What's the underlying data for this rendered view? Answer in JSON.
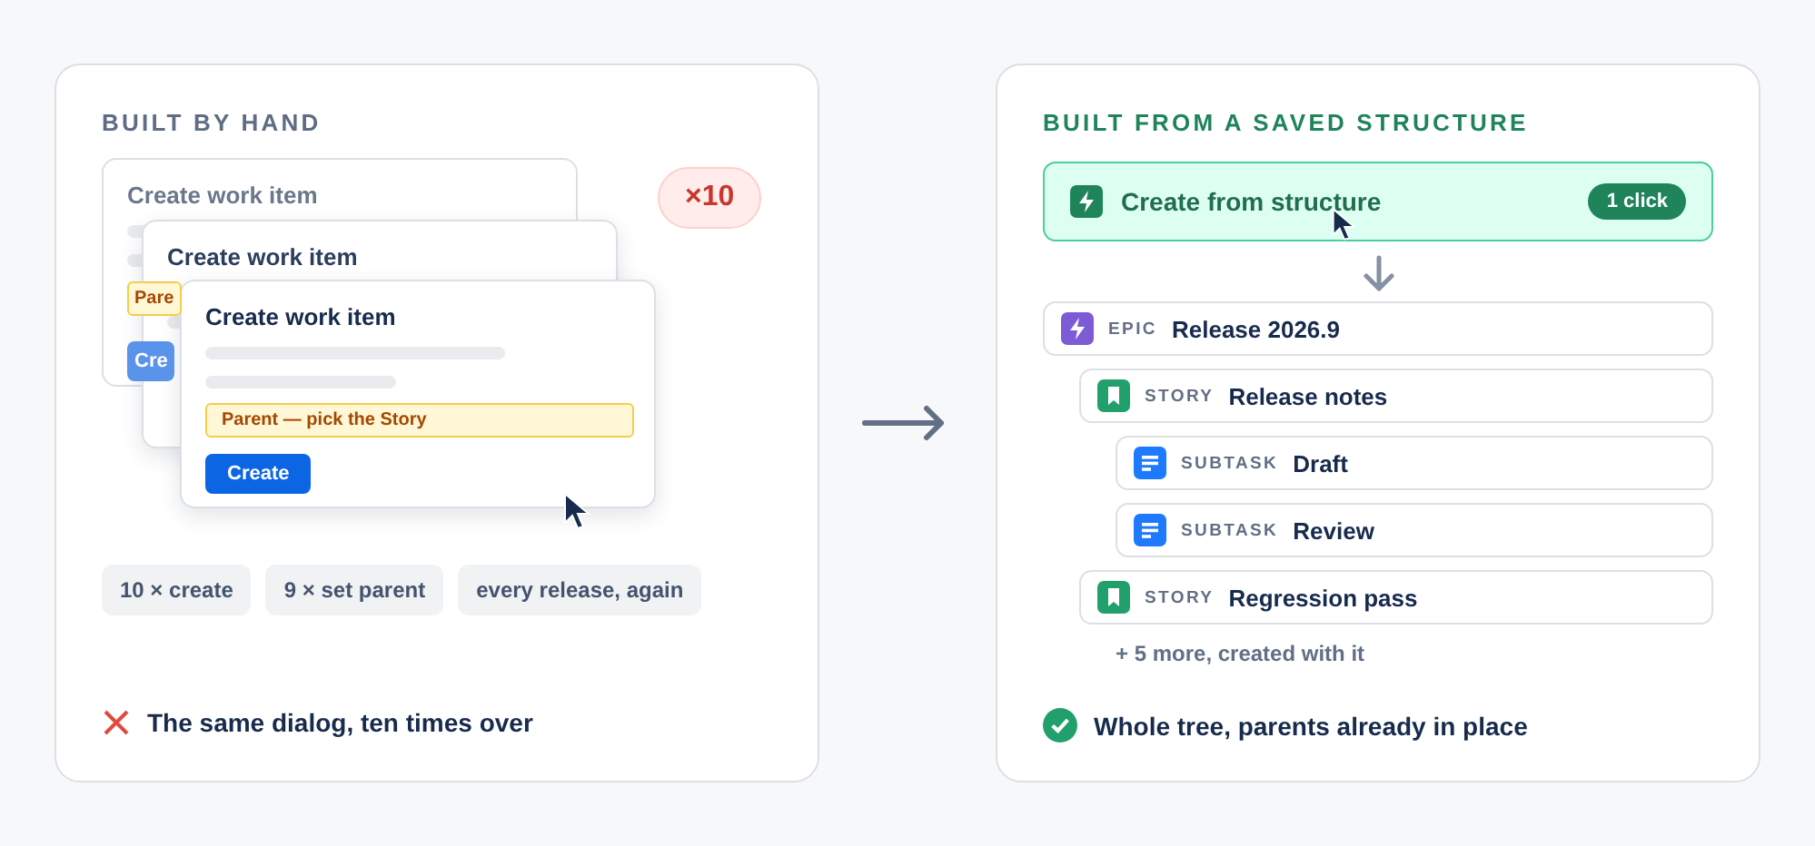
{
  "manual": {
    "heading": "BUILT BY HAND",
    "dialogs": [
      {
        "title": "Create work item",
        "parent_field": "Pare",
        "button": "Cre"
      },
      {
        "title": "Create work item"
      },
      {
        "title": "Create work item",
        "parent_field": "Parent — pick the Story",
        "button": "Create"
      }
    ],
    "repeat_badge": "×10",
    "chips": [
      "10 × create",
      "9 × set parent",
      "every release, again"
    ],
    "verdict": "The same dialog, ten times over"
  },
  "structure": {
    "heading": "BUILT FROM A SAVED STRUCTURE",
    "action": {
      "label": "Create from structure",
      "badge": "1 click"
    },
    "tree": [
      {
        "kind": "epic",
        "type": "EPIC",
        "title": "Release 2026.9",
        "children": [
          {
            "kind": "story",
            "type": "STORY",
            "title": "Release notes",
            "children": [
              {
                "kind": "subtask",
                "type": "SUBTASK",
                "title": "Draft"
              },
              {
                "kind": "subtask",
                "type": "SUBTASK",
                "title": "Review"
              }
            ]
          },
          {
            "kind": "story",
            "type": "STORY",
            "title": "Regression pass"
          }
        ]
      }
    ],
    "more": "+ 5 more, created with it",
    "verdict": "Whole tree, parents already in place"
  }
}
